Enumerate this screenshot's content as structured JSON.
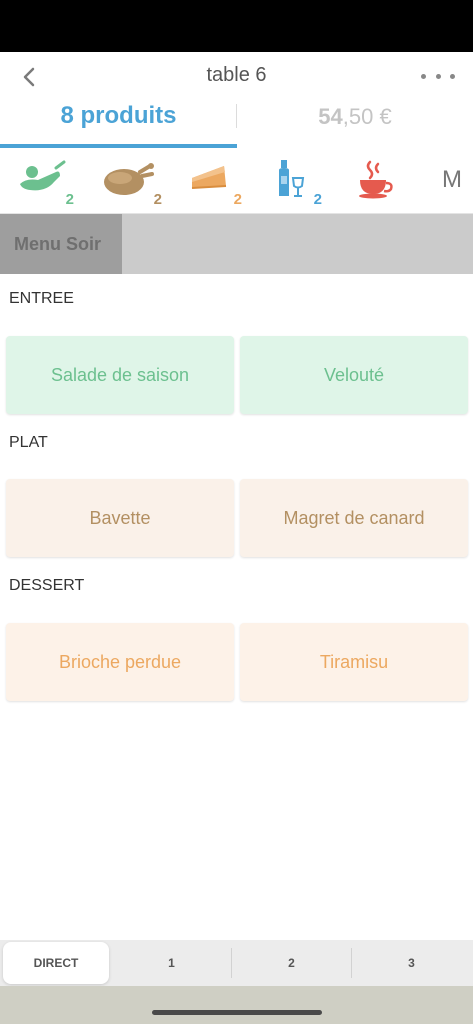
{
  "nav": {
    "title": "table 6"
  },
  "tabs": {
    "products_label": "8 produits",
    "total_euros": "54",
    "total_cents": ",50 €"
  },
  "categories": {
    "items": [
      {
        "icon": "dish-icon",
        "badge": "2",
        "color": "#6cc08f"
      },
      {
        "icon": "roast-chicken-icon",
        "badge": "2",
        "color": "#b39062"
      },
      {
        "icon": "cake-slice-icon",
        "badge": "2",
        "color": "#eca860"
      },
      {
        "icon": "bottle-glass-icon",
        "badge": "2",
        "color": "#4ba3d6"
      },
      {
        "icon": "hot-cup-icon",
        "badge": "",
        "color": "#e55a4e"
      }
    ],
    "more_label": "M"
  },
  "menu": {
    "tab_label": "Menu Soir"
  },
  "sections": [
    {
      "title": "ENTREE",
      "items": [
        "Salade de saison",
        "Velouté"
      ]
    },
    {
      "title": "PLAT",
      "items": [
        "Bavette",
        "Magret de canard"
      ]
    },
    {
      "title": "DESSERT",
      "items": [
        "Brioche perdue",
        "Tiramisu"
      ]
    }
  ],
  "bottom": {
    "segments": [
      "DIRECT",
      "1",
      "2",
      "3"
    ]
  },
  "colors": {
    "accent": "#4ba3d6",
    "entree": "#6cc08f",
    "plat": "#b39062",
    "dessert": "#eca860"
  }
}
